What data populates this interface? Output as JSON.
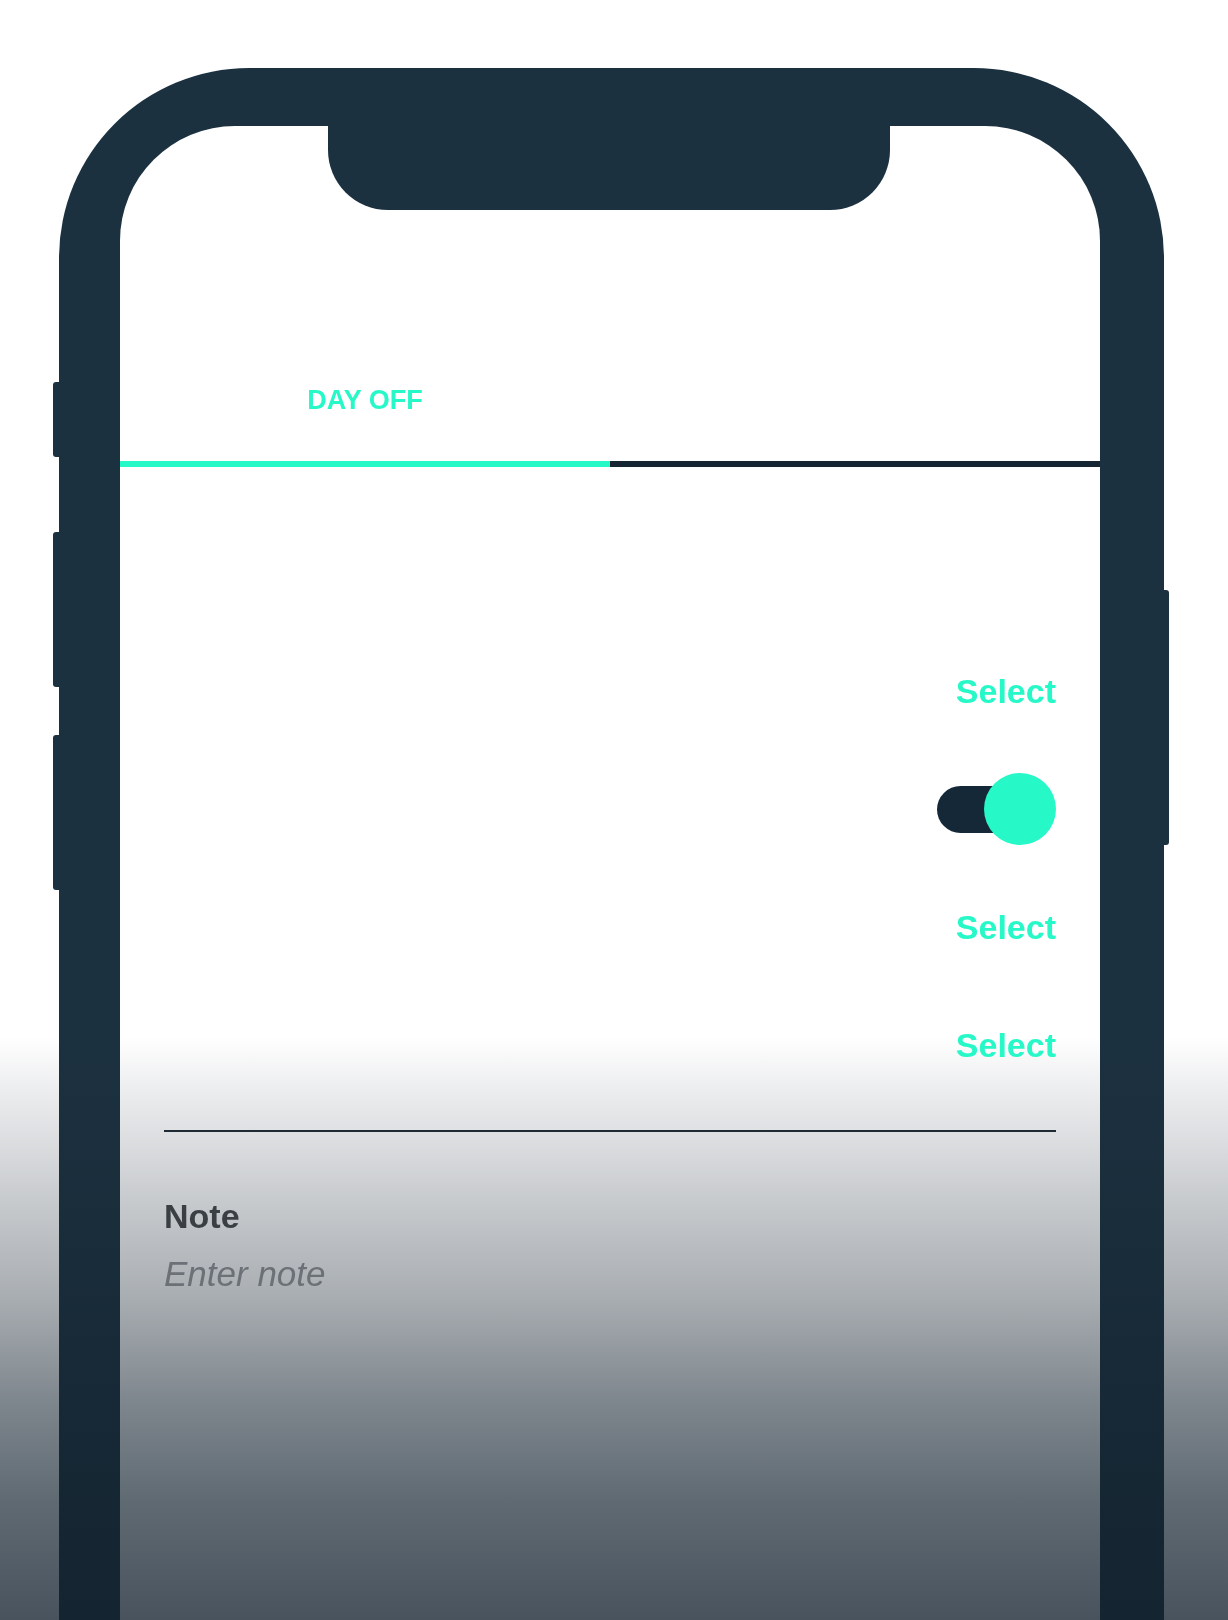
{
  "tabs": [
    {
      "label": "DAY OFF",
      "selected": true
    },
    {
      "selected": false
    }
  ],
  "rows": [
    {
      "kind": "select",
      "action": "Select"
    },
    {
      "kind": "toggle",
      "on": true
    },
    {
      "kind": "select",
      "action": "Select"
    },
    {
      "kind": "select",
      "action": "Select"
    }
  ],
  "note": {
    "label": "Note",
    "placeholder": "Enter note"
  }
}
